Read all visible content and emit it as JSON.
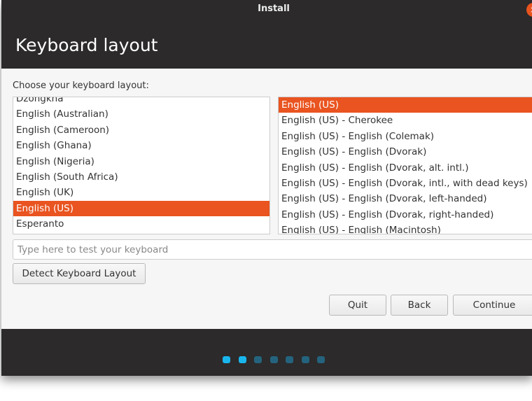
{
  "window": {
    "title": "Install"
  },
  "header": {
    "title": "Keyboard layout"
  },
  "prompt": "Choose your keyboard layout:",
  "layouts": [
    "Dzongkha",
    "English (Australian)",
    "English (Cameroon)",
    "English (Ghana)",
    "English (Nigeria)",
    "English (South Africa)",
    "English (UK)",
    "English (US)",
    "Esperanto"
  ],
  "layouts_selected": "English (US)",
  "variants": [
    "English (US)",
    "English (US) - Cherokee",
    "English (US) - English (Colemak)",
    "English (US) - English (Dvorak)",
    "English (US) - English (Dvorak, alt. intl.)",
    "English (US) - English (Dvorak, intl., with dead keys)",
    "English (US) - English (Dvorak, left-handed)",
    "English (US) - English (Dvorak, right-handed)",
    "English (US) - English (Macintosh)"
  ],
  "variants_selected": "English (US)",
  "test_input": {
    "placeholder": "Type here to test your keyboard",
    "value": ""
  },
  "buttons": {
    "detect": "Detect Keyboard Layout",
    "quit": "Quit",
    "back": "Back",
    "continue": "Continue"
  },
  "progress": {
    "total_steps": 7,
    "completed_steps": 2
  },
  "colors": {
    "accent": "#e95420",
    "progress_active": "#19b6ee",
    "progress_inactive": "#24637e"
  }
}
